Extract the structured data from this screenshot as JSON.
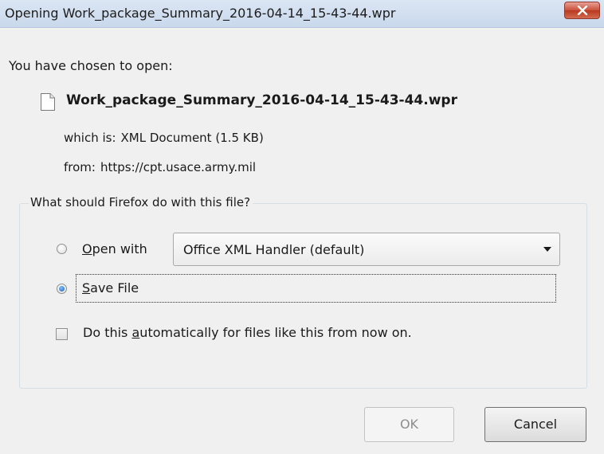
{
  "window": {
    "title": "Opening Work_package_Summary_2016-04-14_15-43-44.wpr"
  },
  "intro_text": "You have chosen to open:",
  "file": {
    "name": "Work_package_Summary_2016-04-14_15-43-44.wpr",
    "type_label": "which is:",
    "type_value": "XML Document (1.5 KB)",
    "source_label": "from:",
    "source_value": "https://cpt.usace.army.mil"
  },
  "action_group": {
    "legend": "What should Firefox do with this file?",
    "open_with": {
      "label_accel": "O",
      "label_rest": "pen with",
      "selected": false,
      "handler": "Office XML Handler (default)"
    },
    "save_file": {
      "label_accel": "S",
      "label_rest": "ave File",
      "selected": true
    },
    "auto": {
      "label_before": "Do this ",
      "label_accel": "a",
      "label_rest": "utomatically for files like this from now on.",
      "checked": false
    }
  },
  "buttons": {
    "ok": "OK",
    "cancel": "Cancel",
    "ok_enabled": false
  },
  "icons": {
    "close": "close-icon",
    "file": "document-icon",
    "dropdown": "chevron-down-icon"
  },
  "colors": {
    "titlebar": "#c9d8ec",
    "close_button": "#c9503a",
    "radio_selected": "#1d5fae",
    "background": "#f0f0f0"
  }
}
